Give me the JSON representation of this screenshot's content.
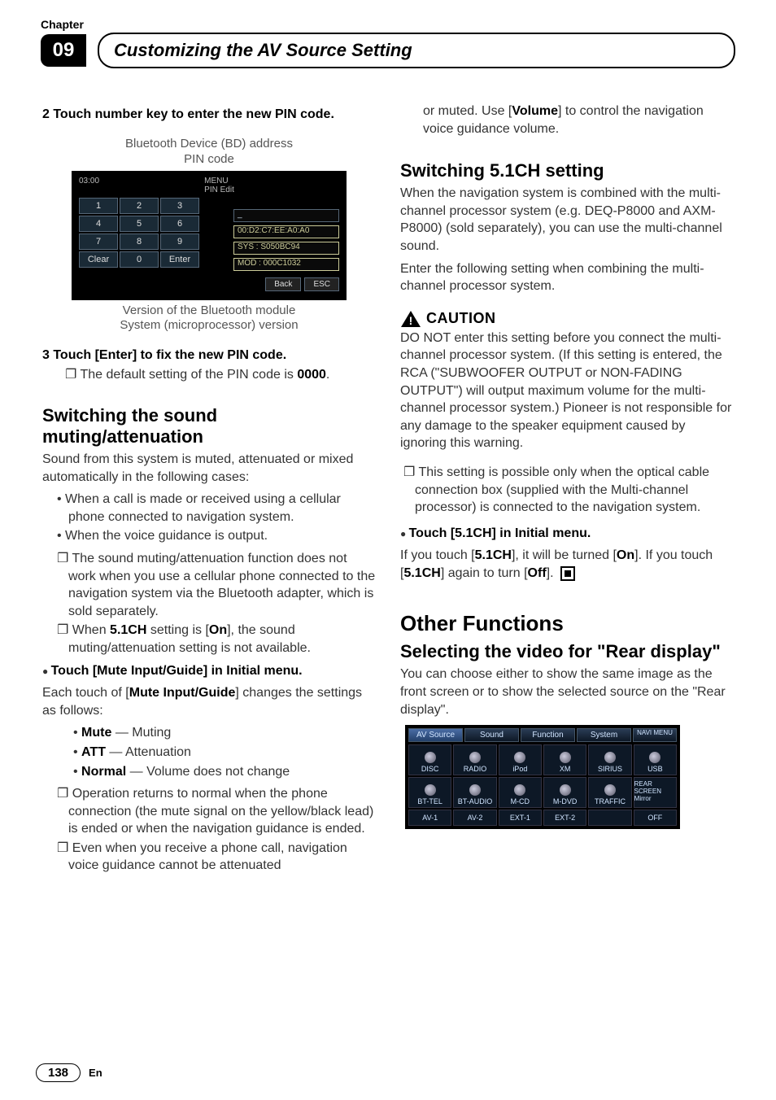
{
  "header": {
    "chapter_label": "Chapter",
    "chapter_number": "09",
    "title": "Customizing the AV Source Setting"
  },
  "left": {
    "step2": "2    Touch number key to enter the new PIN code.",
    "pin_caption_top1": "Bluetooth Device (BD) address",
    "pin_caption_top2": "PIN code",
    "pin_editor": {
      "time": "03:00",
      "menu_label": "MENU",
      "sub_label": "PIN Edit",
      "keys": [
        "1",
        "2",
        "3",
        "4",
        "5",
        "6",
        "7",
        "8",
        "9",
        "Clear",
        "0",
        "Enter"
      ],
      "field_pin": "_",
      "field_bd": "00:D2:C7:EE:A0:A0",
      "field_sys": "SYS : S050BC94",
      "field_mod": "MOD : 000C1032",
      "back": "Back",
      "esc": "ESC"
    },
    "pin_caption_bot1": "Version of the Bluetooth module",
    "pin_caption_bot2": "System (microprocessor) version",
    "step3": "3    Touch [Enter] to fix the new PIN code.",
    "step3_sub_pre": "The default setting of the PIN code is ",
    "step3_sub_bold": "0000",
    "step3_sub_post": ".",
    "h_mute": "Switching the sound muting/attenuation",
    "mute_p1": "Sound from this system is muted, attenuated or mixed automatically in the following cases:",
    "mute_b1": "When a call is made or received using a cellular phone connected to navigation system.",
    "mute_b2": "When the voice guidance is output.",
    "mute_sq1": "The sound muting/attenuation function does not work when you use a cellular phone connected to the navigation system via the Bluetooth adapter, which is sold separately.",
    "mute_sq2_pre": "When ",
    "mute_sq2_b1": "5.1CH",
    "mute_sq2_mid": " setting is [",
    "mute_sq2_b2": "On",
    "mute_sq2_post": "], the sound muting/attenuation setting is not available.",
    "touch_mute": "Touch [Mute Input/Guide] in Initial menu.",
    "touch_mute_p_pre": "Each touch of [",
    "touch_mute_p_b": "Mute Input/Guide",
    "touch_mute_p_post": "] changes the settings as follows:",
    "opt_mute_b": "Mute",
    "opt_mute_t": " — Muting",
    "opt_att_b": "ATT",
    "opt_att_t": " — Attenuation",
    "opt_norm_b": "Normal",
    "opt_norm_t": " — Volume does not change",
    "opt_sq1": "Operation returns to normal when the phone connection (the mute signal on the yellow/black lead) is ended or when the navigation guidance is ended.",
    "opt_sq2": "Even when you receive a phone call, navigation voice guidance cannot be attenuated"
  },
  "right": {
    "cont_p_pre": "or muted. Use [",
    "cont_p_b": "Volume",
    "cont_p_post": "] to control the navigation voice guidance volume.",
    "h_51": "Switching 5.1CH setting",
    "p51a": "When the navigation system is combined with the multi-channel processor system (e.g. DEQ-P8000 and AXM-P8000) (sold separately), you can use the multi-channel sound.",
    "p51b": "Enter the following setting when combining the multi-channel processor system.",
    "caution_label": "CAUTION",
    "caution_body": "DO NOT enter this setting before you connect the multi-channel processor system. (If this setting is entered, the RCA (\"SUBWOOFER OUTPUT or NON-FADING OUTPUT\") will output maximum volume for the multi-channel processor system.) Pioneer is not responsible for any damage to the speaker equipment caused by ignoring this warning.",
    "sq51": "This setting is possible only when the optical cable connection box (supplied with the Multi-channel processor) is connected to the navigation system.",
    "touch51": "Touch [5.1CH] in Initial menu.",
    "touch51_p_pre": "If you touch [",
    "touch51_b1": "5.1CH",
    "touch51_mid1": "], it will be turned [",
    "touch51_b2": "On",
    "touch51_mid2": "]. If you touch [",
    "touch51_b3": "5.1CH",
    "touch51_mid3": "] again to turn [",
    "touch51_b4": "Off",
    "touch51_post": "].",
    "h_other": "Other Functions",
    "h_rear": "Selecting the video for \"Rear display\"",
    "rear_p": "You can choose either to show the same image as the front screen or to show the selected source on the \"Rear display\".",
    "av": {
      "tabs": [
        "AV Source",
        "Sound",
        "Function",
        "System"
      ],
      "navi": "NAVI MENU",
      "row1": [
        "DISC",
        "RADIO",
        "iPod",
        "XM",
        "SIRIUS",
        "USB"
      ],
      "row2": [
        "BT-TEL",
        "BT-AUDIO",
        "M-CD",
        "M-DVD",
        "TRAFFIC"
      ],
      "rear": "REAR SCREEN Mirror",
      "row3": [
        "AV-1",
        "AV-2",
        "EXT-1",
        "EXT-2",
        "",
        "OFF"
      ]
    }
  },
  "footer": {
    "page": "138",
    "lang": "En"
  }
}
